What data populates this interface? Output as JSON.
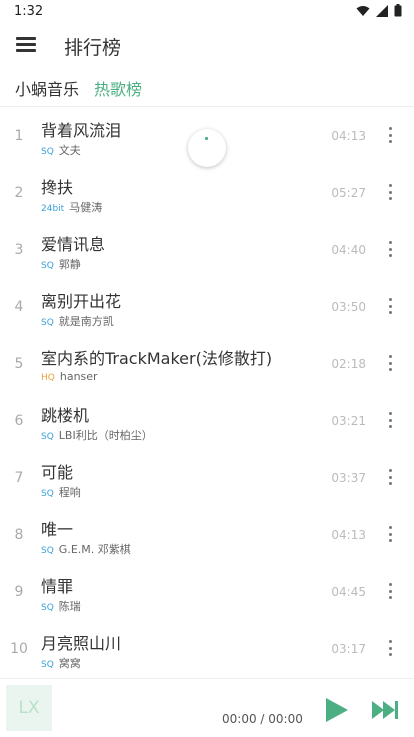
{
  "status_bar": {
    "time": "1:32"
  },
  "app_bar": {
    "title": "排行榜"
  },
  "tabs": [
    {
      "label": "小蜗音乐",
      "active": false
    },
    {
      "label": "热歌榜",
      "active": true
    }
  ],
  "songs": [
    {
      "index": "1",
      "name": "背着风流泪",
      "quality": "SQ",
      "artist": "文夫",
      "duration": "04:13"
    },
    {
      "index": "2",
      "name": "搀扶",
      "quality": "24bit",
      "artist": "马健涛",
      "duration": "05:27"
    },
    {
      "index": "3",
      "name": "爱情讯息",
      "quality": "SQ",
      "artist": "郭静",
      "duration": "04:40"
    },
    {
      "index": "4",
      "name": "离别开出花",
      "quality": "SQ",
      "artist": "就是南方凯",
      "duration": "03:50"
    },
    {
      "index": "5",
      "name": "室内系的TrackMaker(法修散打)",
      "quality": "HQ",
      "artist": "hanser",
      "duration": "02:18"
    },
    {
      "index": "6",
      "name": "跳楼机",
      "quality": "SQ",
      "artist": "LBI利比（时柏尘）",
      "duration": "03:21"
    },
    {
      "index": "7",
      "name": "可能",
      "quality": "SQ",
      "artist": "程响",
      "duration": "03:37"
    },
    {
      "index": "8",
      "name": "唯一",
      "quality": "SQ",
      "artist": "G.E.M. 邓紫棋",
      "duration": "04:13"
    },
    {
      "index": "9",
      "name": "情罪",
      "quality": "SQ",
      "artist": "陈瑞",
      "duration": "04:45"
    },
    {
      "index": "10",
      "name": "月亮照山川",
      "quality": "SQ",
      "artist": "窝窝",
      "duration": "03:17"
    }
  ],
  "player": {
    "cover_text": "LX",
    "time": "00:00 / 00:00"
  },
  "colors": {
    "accent": "#4caf84",
    "sq": "#3aa0d8",
    "hq": "#e8a33c",
    "bit24": "#3aa0d8"
  },
  "icons": {
    "menu": "menu-icon",
    "wifi": "wifi-icon",
    "signal": "signal-icon",
    "battery": "battery-icon",
    "more": "more-vert-icon",
    "play": "play-icon",
    "next": "skip-next-icon"
  }
}
